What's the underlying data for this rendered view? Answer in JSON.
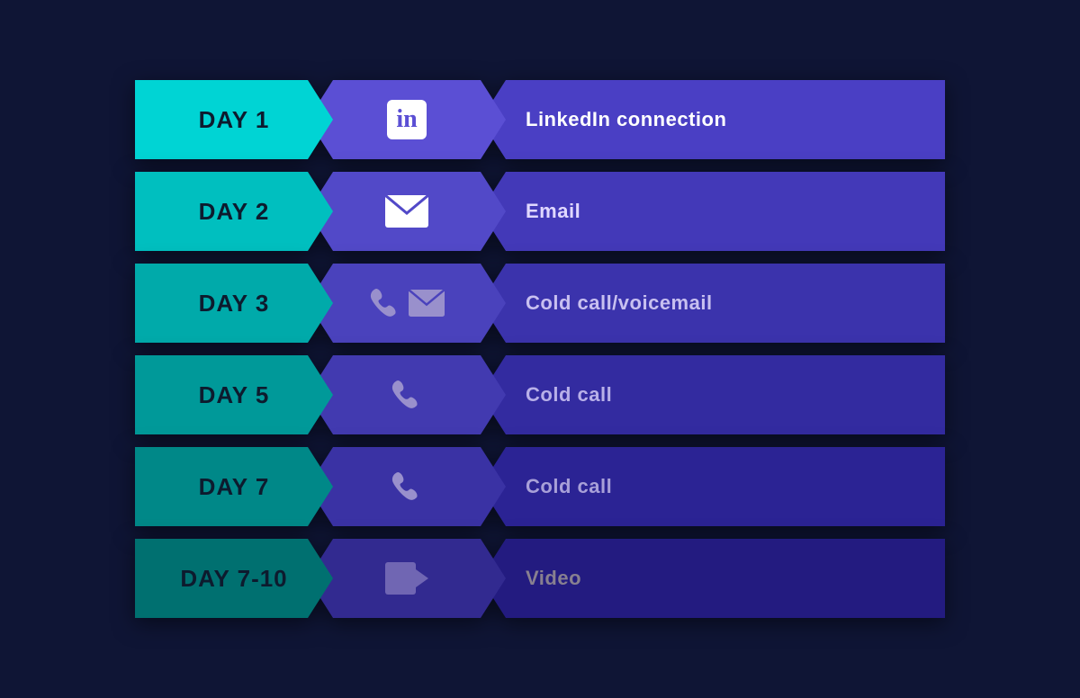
{
  "rows": [
    {
      "id": "row-1",
      "day": "DAY 1",
      "icon_type": "linkedin",
      "action": "LinkedIn connection"
    },
    {
      "id": "row-2",
      "day": "DAY 2",
      "icon_type": "email",
      "action": "Email"
    },
    {
      "id": "row-3",
      "day": "DAY 3",
      "icon_type": "phone-email",
      "action": "Cold call/voicemail"
    },
    {
      "id": "row-4",
      "day": "DAY 5",
      "icon_type": "phone",
      "action": "Cold call"
    },
    {
      "id": "row-5",
      "day": "DAY 7",
      "icon_type": "phone",
      "action": "Cold call"
    },
    {
      "id": "row-6",
      "day": "DAY 7-10",
      "icon_type": "video",
      "action": "Video"
    }
  ]
}
